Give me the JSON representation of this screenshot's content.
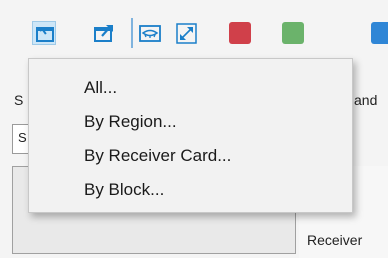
{
  "toolbar": {
    "buttons": [
      {
        "name": "import",
        "icon": "import-screen-icon",
        "active": true
      },
      {
        "name": "export",
        "icon": "export-screen-icon",
        "active": false
      },
      {
        "name": "view",
        "icon": "eye-frame-icon",
        "active": false
      },
      {
        "name": "fullscreen",
        "icon": "expand-diagonal-icon",
        "active": false
      }
    ],
    "swatches": [
      {
        "name": "red",
        "color": "#d0404a"
      },
      {
        "name": "green",
        "color": "#6bb36b"
      },
      {
        "name": "blue",
        "color": "#2f86d6"
      }
    ],
    "accent_color": "#1b7fc9"
  },
  "menu": {
    "items": [
      {
        "label": "All..."
      },
      {
        "label": "By Region..."
      },
      {
        "label": "By Receiver Card..."
      },
      {
        "label": "By Block..."
      }
    ]
  },
  "background": {
    "left_label_fragment": "S",
    "right_label_fragment": "and",
    "field_fragment": "S",
    "bottom_label": "Receiver"
  }
}
